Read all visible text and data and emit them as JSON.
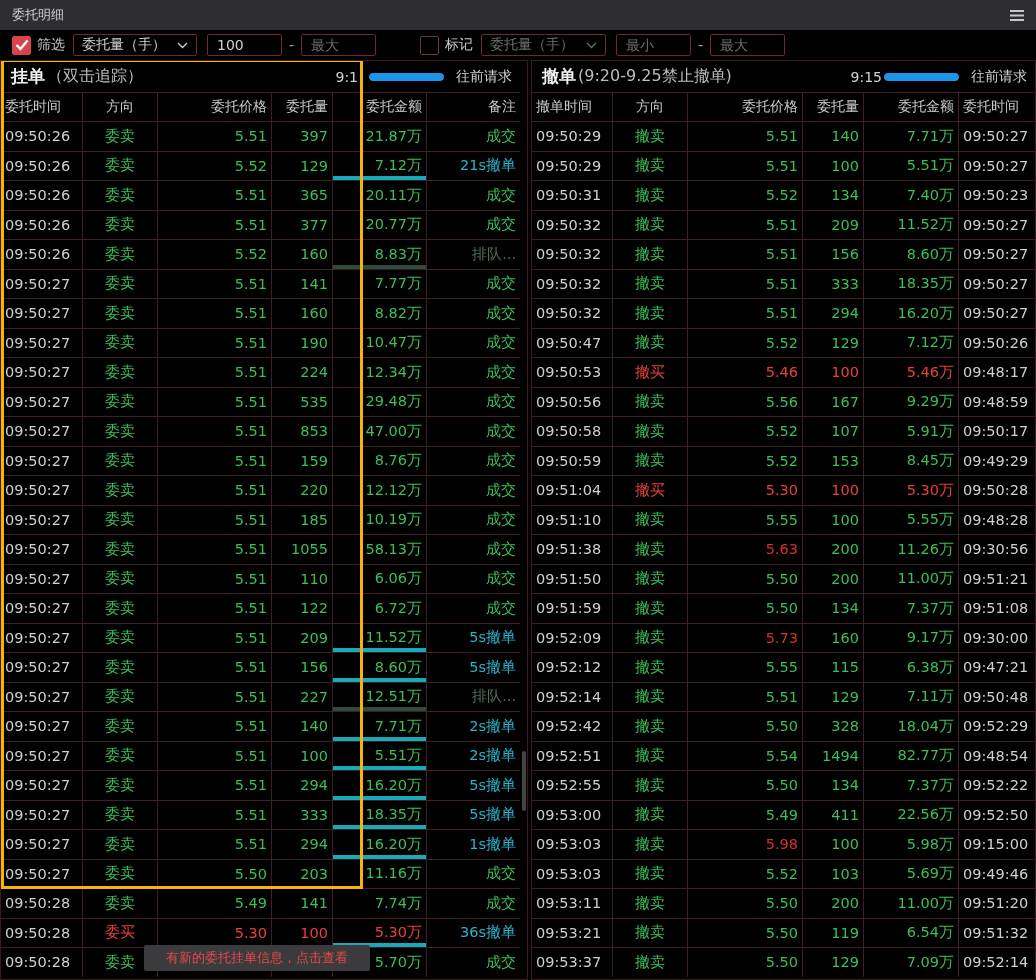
{
  "window": {
    "title": "委托明细"
  },
  "filter": {
    "label": "筛选",
    "checked": true,
    "field": "委托量（手）",
    "min": "100",
    "dash": "-",
    "max_placeholder": "最大"
  },
  "mark": {
    "label": "标记",
    "checked": false,
    "field": "委托量（手）",
    "min_placeholder": "最小",
    "dash": "-",
    "max_placeholder": "最大"
  },
  "pending": {
    "title": "挂单",
    "subtitle": "（双击追踪）",
    "time": "9:1",
    "progress": {
      "level": 1
    },
    "request": "往前请求",
    "columns": [
      "委托时间",
      "方向",
      "委托价格",
      "委托量",
      "委托金额",
      "备注"
    ],
    "rows": [
      {
        "time": "09:50:26",
        "buy": false,
        "direction": "委卖",
        "price": "5.51",
        "qty": "397",
        "amount": "21.87万",
        "remark": "成交",
        "kind": "filled"
      },
      {
        "time": "09:50:26",
        "buy": false,
        "direction": "委卖",
        "price": "5.52",
        "qty": "129",
        "amount": "7.12万",
        "remark": "21s撤单",
        "kind": "cancelled"
      },
      {
        "time": "09:50:26",
        "buy": false,
        "direction": "委卖",
        "price": "5.51",
        "qty": "365",
        "amount": "20.11万",
        "remark": "成交",
        "kind": "filled"
      },
      {
        "time": "09:50:26",
        "buy": false,
        "direction": "委卖",
        "price": "5.51",
        "qty": "377",
        "amount": "20.77万",
        "remark": "成交",
        "kind": "filled"
      },
      {
        "time": "09:50:26",
        "buy": false,
        "direction": "委卖",
        "price": "5.52",
        "qty": "160",
        "amount": "8.83万",
        "remark": "排队...",
        "kind": "queued"
      },
      {
        "time": "09:50:27",
        "buy": false,
        "direction": "委卖",
        "price": "5.51",
        "qty": "141",
        "amount": "7.77万",
        "remark": "成交",
        "kind": "filled"
      },
      {
        "time": "09:50:27",
        "buy": false,
        "direction": "委卖",
        "price": "5.51",
        "qty": "160",
        "amount": "8.82万",
        "remark": "成交",
        "kind": "filled"
      },
      {
        "time": "09:50:27",
        "buy": false,
        "direction": "委卖",
        "price": "5.51",
        "qty": "190",
        "amount": "10.47万",
        "remark": "成交",
        "kind": "filled"
      },
      {
        "time": "09:50:27",
        "buy": false,
        "direction": "委卖",
        "price": "5.51",
        "qty": "224",
        "amount": "12.34万",
        "remark": "成交",
        "kind": "filled"
      },
      {
        "time": "09:50:27",
        "buy": false,
        "direction": "委卖",
        "price": "5.51",
        "qty": "535",
        "amount": "29.48万",
        "remark": "成交",
        "kind": "filled"
      },
      {
        "time": "09:50:27",
        "buy": false,
        "direction": "委卖",
        "price": "5.51",
        "qty": "853",
        "amount": "47.00万",
        "remark": "成交",
        "kind": "filled"
      },
      {
        "time": "09:50:27",
        "buy": false,
        "direction": "委卖",
        "price": "5.51",
        "qty": "159",
        "amount": "8.76万",
        "remark": "成交",
        "kind": "filled"
      },
      {
        "time": "09:50:27",
        "buy": false,
        "direction": "委卖",
        "price": "5.51",
        "qty": "220",
        "amount": "12.12万",
        "remark": "成交",
        "kind": "filled"
      },
      {
        "time": "09:50:27",
        "buy": false,
        "direction": "委卖",
        "price": "5.51",
        "qty": "185",
        "amount": "10.19万",
        "remark": "成交",
        "kind": "filled"
      },
      {
        "time": "09:50:27",
        "buy": false,
        "direction": "委卖",
        "price": "5.51",
        "qty": "1055",
        "amount": "58.13万",
        "remark": "成交",
        "kind": "filled"
      },
      {
        "time": "09:50:27",
        "buy": false,
        "direction": "委卖",
        "price": "5.51",
        "qty": "110",
        "amount": "6.06万",
        "remark": "成交",
        "kind": "filled"
      },
      {
        "time": "09:50:27",
        "buy": false,
        "direction": "委卖",
        "price": "5.51",
        "qty": "122",
        "amount": "6.72万",
        "remark": "成交",
        "kind": "filled"
      },
      {
        "time": "09:50:27",
        "buy": false,
        "direction": "委卖",
        "price": "5.51",
        "qty": "209",
        "amount": "11.52万",
        "remark": "5s撤单",
        "kind": "cancelled"
      },
      {
        "time": "09:50:27",
        "buy": false,
        "direction": "委卖",
        "price": "5.51",
        "qty": "156",
        "amount": "8.60万",
        "remark": "5s撤单",
        "kind": "cancelled"
      },
      {
        "time": "09:50:27",
        "buy": false,
        "direction": "委卖",
        "price": "5.51",
        "qty": "227",
        "amount": "12.51万",
        "remark": "排队...",
        "kind": "queued"
      },
      {
        "time": "09:50:27",
        "buy": false,
        "direction": "委卖",
        "price": "5.51",
        "qty": "140",
        "amount": "7.71万",
        "remark": "2s撤单",
        "kind": "cancelled"
      },
      {
        "time": "09:50:27",
        "buy": false,
        "direction": "委卖",
        "price": "5.51",
        "qty": "100",
        "amount": "5.51万",
        "remark": "2s撤单",
        "kind": "cancelled"
      },
      {
        "time": "09:50:27",
        "buy": false,
        "direction": "委卖",
        "price": "5.51",
        "qty": "294",
        "amount": "16.20万",
        "remark": "5s撤单",
        "kind": "cancelled"
      },
      {
        "time": "09:50:27",
        "buy": false,
        "direction": "委卖",
        "price": "5.51",
        "qty": "333",
        "amount": "18.35万",
        "remark": "5s撤单",
        "kind": "cancelled"
      },
      {
        "time": "09:50:27",
        "buy": false,
        "direction": "委卖",
        "price": "5.51",
        "qty": "294",
        "amount": "16.20万",
        "remark": "1s撤单",
        "kind": "cancelled"
      },
      {
        "time": "09:50:27",
        "buy": false,
        "direction": "委卖",
        "price": "5.50",
        "qty": "203",
        "amount": "11.16万",
        "remark": "成交",
        "kind": "filled"
      },
      {
        "time": "09:50:28",
        "buy": false,
        "direction": "委卖",
        "price": "5.49",
        "qty": "141",
        "amount": "7.74万",
        "remark": "成交",
        "kind": "filled"
      },
      {
        "time": "09:50:28",
        "buy": true,
        "direction": "委买",
        "price": "5.30",
        "qty": "100",
        "amount": "5.30万",
        "remark": "36s撤单",
        "kind": "cancelled"
      },
      {
        "time": "09:50:28",
        "buy": false,
        "direction": "委卖",
        "amount": "5.70万",
        "remark": "成交",
        "kind": "filled"
      }
    ]
  },
  "cancelled": {
    "title": "撤单",
    "subtitle": "(9:20-9.25禁止撤单)",
    "time": "9:15",
    "progress": {
      "level": 1
    },
    "request": "往前请求",
    "columns": [
      "撤单时间",
      "方向",
      "委托价格",
      "委托量",
      "委托金额",
      "委托时间"
    ],
    "rows": [
      {
        "time": "09:50:29",
        "buy": false,
        "direction": "撤卖",
        "price": "5.51",
        "price_high": false,
        "qty": "140",
        "amount": "7.71万",
        "order_time": "09:50:27"
      },
      {
        "time": "09:50:29",
        "buy": false,
        "direction": "撤卖",
        "price": "5.51",
        "price_high": false,
        "qty": "100",
        "amount": "5.51万",
        "order_time": "09:50:27"
      },
      {
        "time": "09:50:31",
        "buy": false,
        "direction": "撤卖",
        "price": "5.52",
        "price_high": false,
        "qty": "134",
        "amount": "7.40万",
        "order_time": "09:50:23"
      },
      {
        "time": "09:50:32",
        "buy": false,
        "direction": "撤卖",
        "price": "5.51",
        "price_high": false,
        "qty": "209",
        "amount": "11.52万",
        "order_time": "09:50:27"
      },
      {
        "time": "09:50:32",
        "buy": false,
        "direction": "撤卖",
        "price": "5.51",
        "price_high": false,
        "qty": "156",
        "amount": "8.60万",
        "order_time": "09:50:27"
      },
      {
        "time": "09:50:32",
        "buy": false,
        "direction": "撤卖",
        "price": "5.51",
        "price_high": false,
        "qty": "333",
        "amount": "18.35万",
        "order_time": "09:50:27"
      },
      {
        "time": "09:50:32",
        "buy": false,
        "direction": "撤卖",
        "price": "5.51",
        "price_high": false,
        "qty": "294",
        "amount": "16.20万",
        "order_time": "09:50:27"
      },
      {
        "time": "09:50:47",
        "buy": false,
        "direction": "撤卖",
        "price": "5.52",
        "price_high": false,
        "qty": "129",
        "amount": "7.12万",
        "order_time": "09:50:26"
      },
      {
        "time": "09:50:53",
        "buy": true,
        "direction": "撤买",
        "price": "5.46",
        "qty": "100",
        "amount": "5.46万",
        "order_time": "09:48:17"
      },
      {
        "time": "09:50:56",
        "buy": false,
        "direction": "撤卖",
        "price": "5.56",
        "price_high": false,
        "qty": "167",
        "amount": "9.29万",
        "order_time": "09:48:59"
      },
      {
        "time": "09:50:58",
        "buy": false,
        "direction": "撤卖",
        "price": "5.52",
        "price_high": false,
        "qty": "107",
        "amount": "5.91万",
        "order_time": "09:50:17"
      },
      {
        "time": "09:50:59",
        "buy": false,
        "direction": "撤卖",
        "price": "5.52",
        "price_high": false,
        "qty": "153",
        "amount": "8.45万",
        "order_time": "09:49:29"
      },
      {
        "time": "09:51:04",
        "buy": true,
        "direction": "撤买",
        "price": "5.30",
        "qty": "100",
        "amount": "5.30万",
        "order_time": "09:50:28"
      },
      {
        "time": "09:51:10",
        "buy": false,
        "direction": "撤卖",
        "price": "5.55",
        "price_high": false,
        "qty": "100",
        "amount": "5.55万",
        "order_time": "09:48:28"
      },
      {
        "time": "09:51:38",
        "buy": false,
        "direction": "撤卖",
        "price": "5.63",
        "price_high": true,
        "qty": "200",
        "amount": "11.26万",
        "order_time": "09:30:56"
      },
      {
        "time": "09:51:50",
        "buy": false,
        "direction": "撤卖",
        "price": "5.50",
        "price_high": false,
        "qty": "200",
        "amount": "11.00万",
        "order_time": "09:51:21"
      },
      {
        "time": "09:51:59",
        "buy": false,
        "direction": "撤卖",
        "price": "5.50",
        "price_high": false,
        "qty": "134",
        "amount": "7.37万",
        "order_time": "09:51:08"
      },
      {
        "time": "09:52:09",
        "buy": false,
        "direction": "撤卖",
        "price": "5.73",
        "price_high": true,
        "qty": "160",
        "amount": "9.17万",
        "order_time": "09:30:00"
      },
      {
        "time": "09:52:12",
        "buy": false,
        "direction": "撤卖",
        "price": "5.55",
        "price_high": false,
        "qty": "115",
        "amount": "6.38万",
        "order_time": "09:47:21"
      },
      {
        "time": "09:52:14",
        "buy": false,
        "direction": "撤卖",
        "price": "5.51",
        "price_high": false,
        "qty": "129",
        "amount": "7.11万",
        "order_time": "09:50:48"
      },
      {
        "time": "09:52:42",
        "buy": false,
        "direction": "撤卖",
        "price": "5.50",
        "price_high": false,
        "qty": "328",
        "amount": "18.04万",
        "order_time": "09:52:29"
      },
      {
        "time": "09:52:51",
        "buy": false,
        "direction": "撤卖",
        "price": "5.54",
        "price_high": false,
        "qty": "1494",
        "amount": "82.77万",
        "order_time": "09:48:54"
      },
      {
        "time": "09:52:55",
        "buy": false,
        "direction": "撤卖",
        "price": "5.50",
        "price_high": false,
        "qty": "134",
        "amount": "7.37万",
        "order_time": "09:52:22"
      },
      {
        "time": "09:53:00",
        "buy": false,
        "direction": "撤卖",
        "price": "5.49",
        "price_high": false,
        "qty": "411",
        "amount": "22.56万",
        "order_time": "09:52:50"
      },
      {
        "time": "09:53:03",
        "buy": false,
        "direction": "撤卖",
        "price": "5.98",
        "price_high": true,
        "qty": "100",
        "amount": "5.98万",
        "order_time": "09:15:00"
      },
      {
        "time": "09:53:03",
        "buy": false,
        "direction": "撤卖",
        "price": "5.52",
        "price_high": false,
        "qty": "103",
        "amount": "5.69万",
        "order_time": "09:49:46"
      },
      {
        "time": "09:53:11",
        "buy": false,
        "direction": "撤卖",
        "price": "5.50",
        "price_high": false,
        "qty": "200",
        "amount": "11.00万",
        "order_time": "09:51:20"
      },
      {
        "time": "09:53:21",
        "buy": false,
        "direction": "撤卖",
        "price": "5.50",
        "price_high": false,
        "qty": "119",
        "amount": "6.54万",
        "order_time": "09:51:32"
      },
      {
        "time": "09:53:37",
        "buy": false,
        "direction": "撤卖",
        "price": "5.50",
        "price_high": false,
        "qty": "129",
        "amount": "7.09万",
        "order_time": "09:52:14"
      }
    ]
  },
  "toast": {
    "text": "有新的委托挂单信息，点击查看"
  }
}
